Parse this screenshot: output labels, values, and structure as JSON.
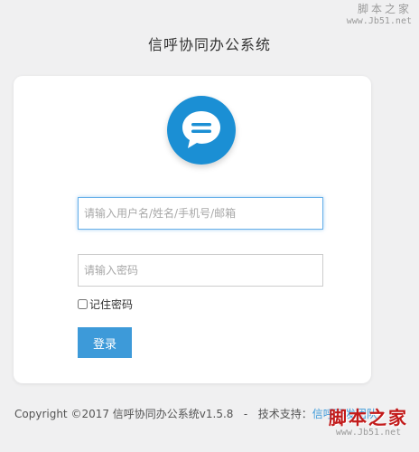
{
  "watermark": {
    "site_name": "脚本之家",
    "url": "www.Jb51.net"
  },
  "page": {
    "title": "信呼协同办公系统"
  },
  "logo": {
    "icon": "chat-bubble-icon",
    "color": "#1b8fd4"
  },
  "form": {
    "username_placeholder": "请输入用户名/姓名/手机号/邮箱",
    "password_placeholder": "请输入密码",
    "remember_label": "记住密码",
    "login_label": "登录"
  },
  "footer": {
    "copyright": "Copyright ©2017 信呼协同办公系统v1.5.8",
    "separator": "-",
    "tech_support_label": "技术支持：",
    "tech_support_link": "信呼开发团队"
  },
  "colors": {
    "accent": "#3d9ad9",
    "background": "#f0f0f1",
    "watermark_red": "#c21a1a"
  }
}
